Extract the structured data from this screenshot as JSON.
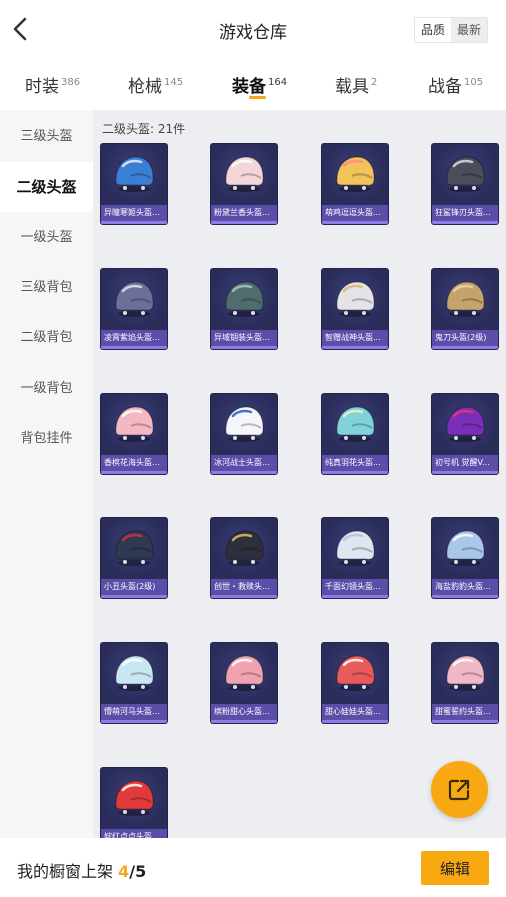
{
  "header": {
    "title": "游戏仓库",
    "sort_quality": "品质",
    "sort_newest": "最新"
  },
  "tabs": [
    {
      "label": "时装",
      "count": "386"
    },
    {
      "label": "枪械",
      "count": "145"
    },
    {
      "label": "装备",
      "count": "164"
    },
    {
      "label": "载具",
      "count": "2"
    },
    {
      "label": "战备",
      "count": "105"
    }
  ],
  "sidebar": [
    {
      "label": "三级头盔"
    },
    {
      "label": "二级头盔"
    },
    {
      "label": "一级头盔"
    },
    {
      "label": "三级背包"
    },
    {
      "label": "二级背包"
    },
    {
      "label": "一级背包"
    },
    {
      "label": "背包挂件"
    }
  ],
  "section": {
    "count_label": "二级头盔: 21件"
  },
  "items": [
    {
      "name": "异瞳寒姬头盔...",
      "color": "#3a7fd6",
      "accent": "#e8f0ff"
    },
    {
      "name": "粉黛兰香头盔...",
      "color": "#f3d6d8",
      "accent": "#ffffff"
    },
    {
      "name": "萌鸡逗逗头盔...",
      "color": "#f3c25a",
      "accent": "#ff8a80"
    },
    {
      "name": "狂鲨锋刃头盔...",
      "color": "#4a4d5a",
      "accent": "#d9dde5"
    },
    {
      "name": "凌霄紫焰头盔...",
      "color": "#6b6f9a",
      "accent": "#e0e2ef"
    },
    {
      "name": "异域锢装头盔...",
      "color": "#4f6c6e",
      "accent": "#a7c7c9"
    },
    {
      "name": "智赠战神头盔...",
      "color": "#e5e3e8",
      "accent": "#d9b86a"
    },
    {
      "name": "鬼刀头盔(2级)",
      "color": "#c5a36a",
      "accent": "#e8d6a8"
    },
    {
      "name": "香槟花海头盔...",
      "color": "#f2b8c4",
      "accent": "#ffffff"
    },
    {
      "name": "冰河战士头盔...",
      "color": "#f4f6fb",
      "accent": "#2a5bc8"
    },
    {
      "name": "纯真羽花头盔...",
      "color": "#7fd3d9",
      "accent": "#f3f0c8"
    },
    {
      "name": "初号机 觉醒V...",
      "color": "#7a2fb8",
      "accent": "#e23c5a"
    },
    {
      "name": "小丑头盔(2级)",
      "color": "#2f3a52",
      "accent": "#d8304a"
    },
    {
      "name": "创世・救赎头...",
      "color": "#2e2f3a",
      "accent": "#e3c060"
    },
    {
      "name": "千面幻镜头盔...",
      "color": "#dfe6f0",
      "accent": "#b0c4de"
    },
    {
      "name": "海盐豹豹头盔...",
      "color": "#a9c7e8",
      "accent": "#ffffff"
    },
    {
      "name": "懵萌河马头盔...",
      "color": "#c9e7f2",
      "accent": "#ffffff"
    },
    {
      "name": "缤粉甜心头盔...",
      "color": "#f1a2b0",
      "accent": "#ffffff"
    },
    {
      "name": "甜心娃娃头盔...",
      "color": "#e85b5b",
      "accent": "#ffffff"
    },
    {
      "name": "甜蜜誓约头盔...",
      "color": "#f0b7c7",
      "accent": "#ffffff"
    },
    {
      "name": "姹红点点头盔...",
      "color": "#e03a3a",
      "accent": "#ffffff"
    }
  ],
  "share_icon": "share-external-icon",
  "bottom": {
    "shelf_label": "我的橱窗上架",
    "shelf_current": "4",
    "shelf_sep": "/",
    "shelf_total": "5",
    "edit_label": "编辑"
  },
  "colors": {
    "accent": "#f8a912",
    "card_bg": "#2b2d5c",
    "label_bg": "#5b4ea8"
  }
}
